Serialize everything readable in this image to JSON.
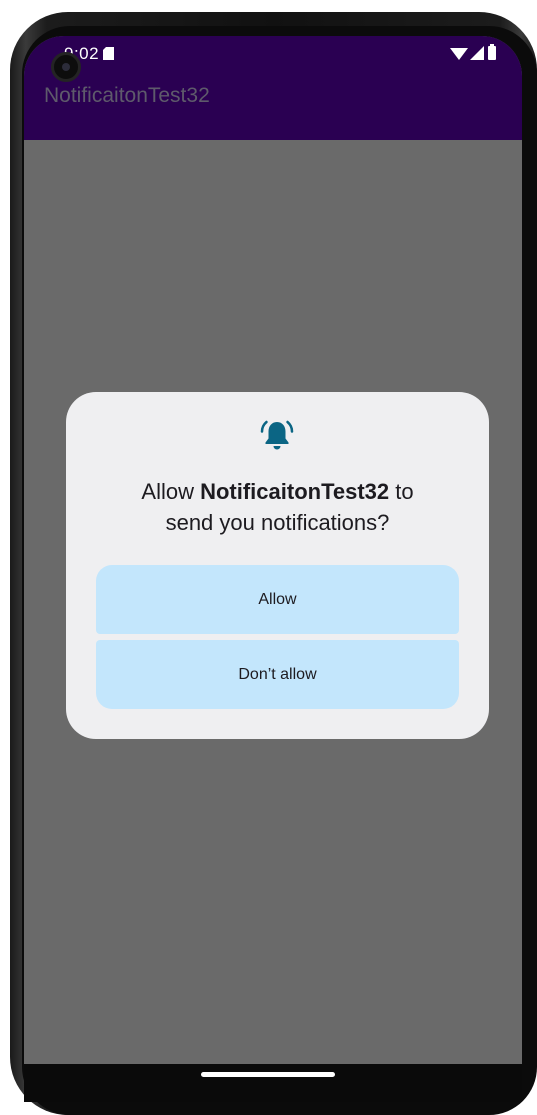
{
  "status_bar": {
    "time": "9:02",
    "icons": [
      "sd-card-icon",
      "wifi-icon",
      "signal-icon",
      "battery-icon"
    ]
  },
  "app_bar": {
    "title": "NotificaitonTest32"
  },
  "dialog": {
    "icon": "bell-ringing-icon",
    "message_prefix": "Allow ",
    "app_name": "NotificaitonTest32",
    "message_suffix_1": " to",
    "message_line_2": "send you notifications?",
    "buttons": [
      {
        "label": "Allow"
      },
      {
        "label": "Don’t allow"
      }
    ]
  },
  "colors": {
    "app_bar": "#2a0052",
    "scrim": "#6a6a6a",
    "dialog_surface": "#efeff1",
    "button": "#c3e6fc",
    "icon": "#0b6584"
  }
}
